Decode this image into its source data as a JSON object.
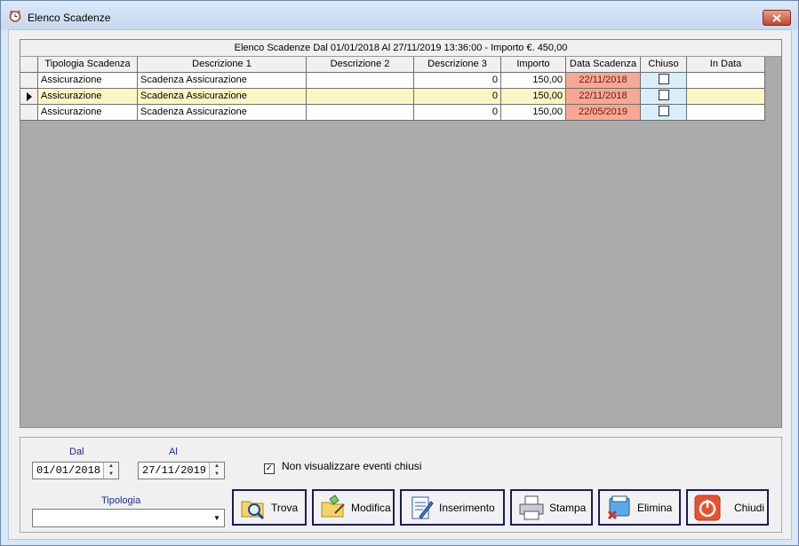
{
  "window": {
    "title": "Elenco Scadenze"
  },
  "grid": {
    "caption": "Elenco Scadenze    Dal  01/01/2018    Al  27/11/2019 13:36:00  -  Importo €. 450,00",
    "columns": [
      "Tipologia Scadenza",
      "Descrizione 1",
      "Descrizione 2",
      "Descrizione 3",
      "Importo",
      "Data Scadenza",
      "Chiuso",
      "In Data"
    ],
    "rows": [
      {
        "tipologia": "Assicurazione",
        "descrizione1": "Scadenza Assicurazione",
        "descrizione2": "",
        "descrizione3": "0",
        "importo": "150,00",
        "data": "22/11/2018",
        "chiuso": false,
        "indata": "",
        "selected": false
      },
      {
        "tipologia": "Assicurazione",
        "descrizione1": "Scadenza Assicurazione",
        "descrizione2": "",
        "descrizione3": "0",
        "importo": "150,00",
        "data": "22/11/2018",
        "chiuso": false,
        "indata": "",
        "selected": true
      },
      {
        "tipologia": "Assicurazione",
        "descrizione1": "Scadenza Assicurazione",
        "descrizione2": "",
        "descrizione3": "0",
        "importo": "150,00",
        "data": "22/05/2019",
        "chiuso": false,
        "indata": "",
        "selected": false
      }
    ]
  },
  "filters": {
    "dal_label": "Dal",
    "dal_value": "01/01/2018",
    "al_label": "Al",
    "al_value": "27/11/2019",
    "hide_closed_label": "Non visualizzare eventi chiusi",
    "hide_closed_checked": true,
    "tipologia_label": "Tipologia",
    "tipologia_value": ""
  },
  "buttons": {
    "trova": "Trova",
    "modifica": "Modifica",
    "inserimento": "Inserimento",
    "stampa": "Stampa",
    "elimina": "Elimina",
    "chiudi": "Chiudi"
  },
  "colors": {
    "selected_row": "#fbf7c5",
    "date_cell": "#f5a994",
    "chiuso_cell": "#d9eefb",
    "label_blue": "#1a2b8c"
  }
}
